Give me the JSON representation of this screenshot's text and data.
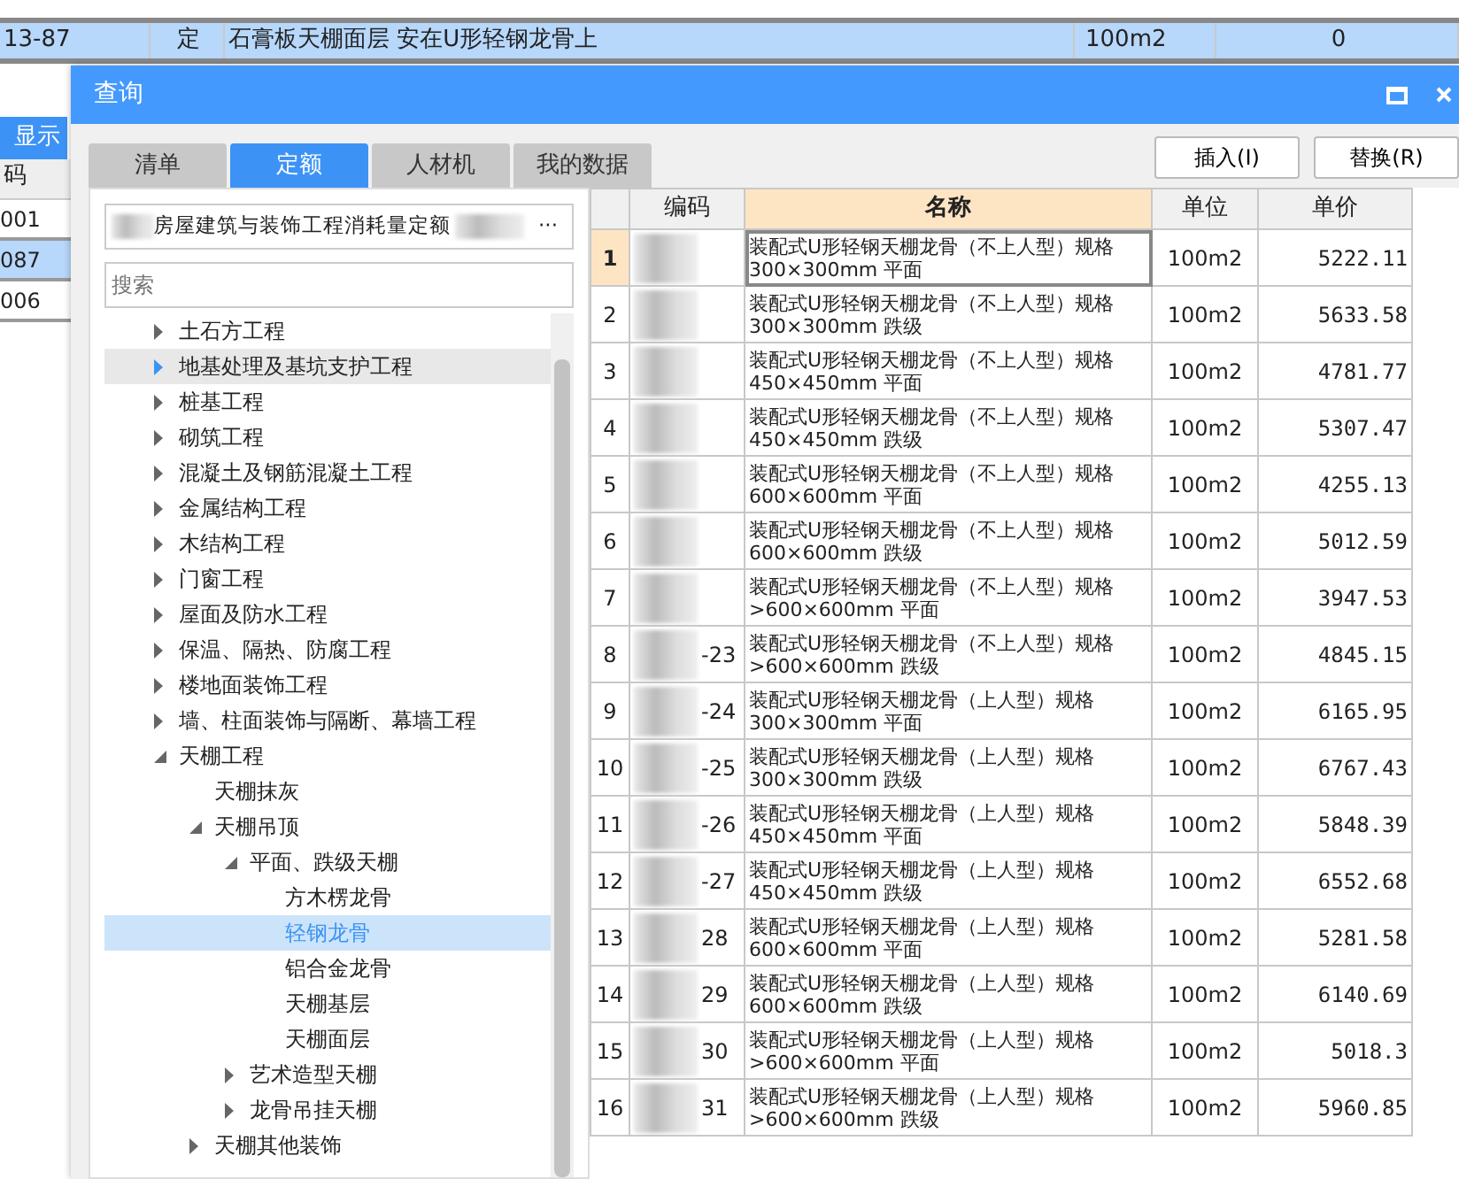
{
  "background": {
    "top_row": {
      "code": "13-87",
      "type": "定",
      "name": "石膏板天棚面层 安在U形轻钢龙骨上",
      "unit": "100m2",
      "amount": "0"
    },
    "side_button": "显示",
    "side_header": "码",
    "side_rows": [
      {
        "text": "001",
        "selected": false
      },
      {
        "text": "087",
        "selected": true
      },
      {
        "text": "006",
        "selected": false
      }
    ]
  },
  "dialog": {
    "title": "查询",
    "tabs": [
      {
        "label": "清单",
        "selected": false
      },
      {
        "label": "定额",
        "selected": true
      },
      {
        "label": "人材机",
        "selected": false
      },
      {
        "label": "我的数据",
        "selected": false
      }
    ],
    "buttons": [
      "插入(I)",
      "替换(R)"
    ],
    "library": {
      "value": "房屋建筑与装饰工程消耗量定额",
      "browse": "···"
    },
    "search": {
      "placeholder": "搜索"
    },
    "tree": [
      {
        "label": "土石方工程",
        "expanded": false,
        "hovered": false
      },
      {
        "label": "地基处理及基坑支护工程",
        "expanded": false,
        "hovered": true
      },
      {
        "label": "桩基工程",
        "expanded": false,
        "hovered": false
      },
      {
        "label": "砌筑工程",
        "expanded": false,
        "hovered": false
      },
      {
        "label": "混凝土及钢筋混凝土工程",
        "expanded": false,
        "hovered": false
      },
      {
        "label": "金属结构工程",
        "expanded": false,
        "hovered": false
      },
      {
        "label": "木结构工程",
        "expanded": false,
        "hovered": false
      },
      {
        "label": "门窗工程",
        "expanded": false,
        "hovered": false
      },
      {
        "label": "屋面及防水工程",
        "expanded": false,
        "hovered": false
      },
      {
        "label": "保温、隔热、防腐工程",
        "expanded": false,
        "hovered": false
      },
      {
        "label": "楼地面装饰工程",
        "expanded": false,
        "hovered": false
      },
      {
        "label": "墙、柱面装饰与隔断、幕墙工程",
        "expanded": false,
        "hovered": false
      },
      {
        "label": "天棚工程",
        "expanded": true,
        "hovered": false,
        "children": [
          {
            "label": "天棚抹灰",
            "selected": false
          },
          {
            "label": "天棚吊顶",
            "expanded": true,
            "hovered": false,
            "children": [
              {
                "label": "平面、跌级天棚",
                "expanded": true,
                "hovered": false,
                "children": [
                  {
                    "label": "方木楞龙骨",
                    "selected": false
                  },
                  {
                    "label": "轻钢龙骨",
                    "selected": true
                  },
                  {
                    "label": "铝合金龙骨",
                    "selected": false
                  },
                  {
                    "label": "天棚基层",
                    "selected": false
                  },
                  {
                    "label": "天棚面层",
                    "selected": false
                  }
                ]
              },
              {
                "label": "艺术造型天棚",
                "expanded": false,
                "hovered": false
              },
              {
                "label": "龙骨吊挂天棚",
                "expanded": false,
                "hovered": false
              }
            ]
          },
          {
            "label": "天棚其他装饰",
            "expanded": false,
            "hovered": false
          }
        ]
      }
    ],
    "table": {
      "columns": [
        {
          "label": "编码",
          "selected": false
        },
        {
          "label": "名称",
          "selected": true
        },
        {
          "label": "单位",
          "selected": false
        },
        {
          "label": "单价",
          "selected": false
        }
      ],
      "rows": [
        {
          "num": "1",
          "selected": true,
          "name": "装配式U形轻钢天棚龙骨（不上人型）规格 300×300mm 平面",
          "unit": "100m2",
          "price": "5222.11"
        },
        {
          "num": "2",
          "selected": false,
          "name": "装配式U形轻钢天棚龙骨（不上人型）规格 300×300mm 跌级",
          "unit": "100m2",
          "price": "5633.58"
        },
        {
          "num": "3",
          "selected": false,
          "name": "装配式U形轻钢天棚龙骨（不上人型）规格 450×450mm 平面",
          "unit": "100m2",
          "price": "4781.77"
        },
        {
          "num": "4",
          "selected": false,
          "name": "装配式U形轻钢天棚龙骨（不上人型）规格 450×450mm 跌级",
          "unit": "100m2",
          "price": "5307.47"
        },
        {
          "num": "5",
          "selected": false,
          "name": "装配式U形轻钢天棚龙骨（不上人型）规格 600×600mm 平面",
          "unit": "100m2",
          "price": "4255.13"
        },
        {
          "num": "6",
          "selected": false,
          "name": "装配式U形轻钢天棚龙骨（不上人型）规格 600×600mm 跌级",
          "unit": "100m2",
          "price": "5012.59"
        },
        {
          "num": "7",
          "selected": false,
          "name": "装配式U形轻钢天棚龙骨（不上人型）规格 >600×600mm 平面",
          "unit": "100m2",
          "price": "3947.53"
        },
        {
          "num": "8",
          "selected": false,
          "code": "-23",
          "name": "装配式U形轻钢天棚龙骨（不上人型）规格 >600×600mm 跌级",
          "unit": "100m2",
          "price": "4845.15"
        },
        {
          "num": "9",
          "selected": false,
          "code": "-24",
          "name": "装配式U形轻钢天棚龙骨（上人型）规格 300×300mm 平面",
          "unit": "100m2",
          "price": "6165.95"
        },
        {
          "num": "10",
          "selected": false,
          "code": "-25",
          "name": "装配式U形轻钢天棚龙骨（上人型）规格 300×300mm 跌级",
          "unit": "100m2",
          "price": "6767.43"
        },
        {
          "num": "11",
          "selected": false,
          "code": "-26",
          "name": "装配式U形轻钢天棚龙骨（上人型）规格 450×450mm 平面",
          "unit": "100m2",
          "price": "5848.39"
        },
        {
          "num": "12",
          "selected": false,
          "code": "-27",
          "name": "装配式U形轻钢天棚龙骨（上人型）规格 450×450mm 跌级",
          "unit": "100m2",
          "price": "6552.68"
        },
        {
          "num": "13",
          "selected": false,
          "code": "28",
          "name": "装配式U形轻钢天棚龙骨（上人型）规格 600×600mm 平面",
          "unit": "100m2",
          "price": "5281.58"
        },
        {
          "num": "14",
          "selected": false,
          "code": "29",
          "name": "装配式U形轻钢天棚龙骨（上人型）规格 600×600mm 跌级",
          "unit": "100m2",
          "price": "6140.69"
        },
        {
          "num": "15",
          "selected": false,
          "code": "30",
          "name": "装配式U形轻钢天棚龙骨（上人型）规格 >600×600mm 平面",
          "unit": "100m2",
          "price": "5018.3"
        },
        {
          "num": "16",
          "selected": false,
          "code": "31",
          "name": "装配式U形轻钢天棚龙骨（上人型）规格 >600×600mm 跌级",
          "unit": "100m2",
          "price": "5960.85"
        }
      ]
    }
  }
}
